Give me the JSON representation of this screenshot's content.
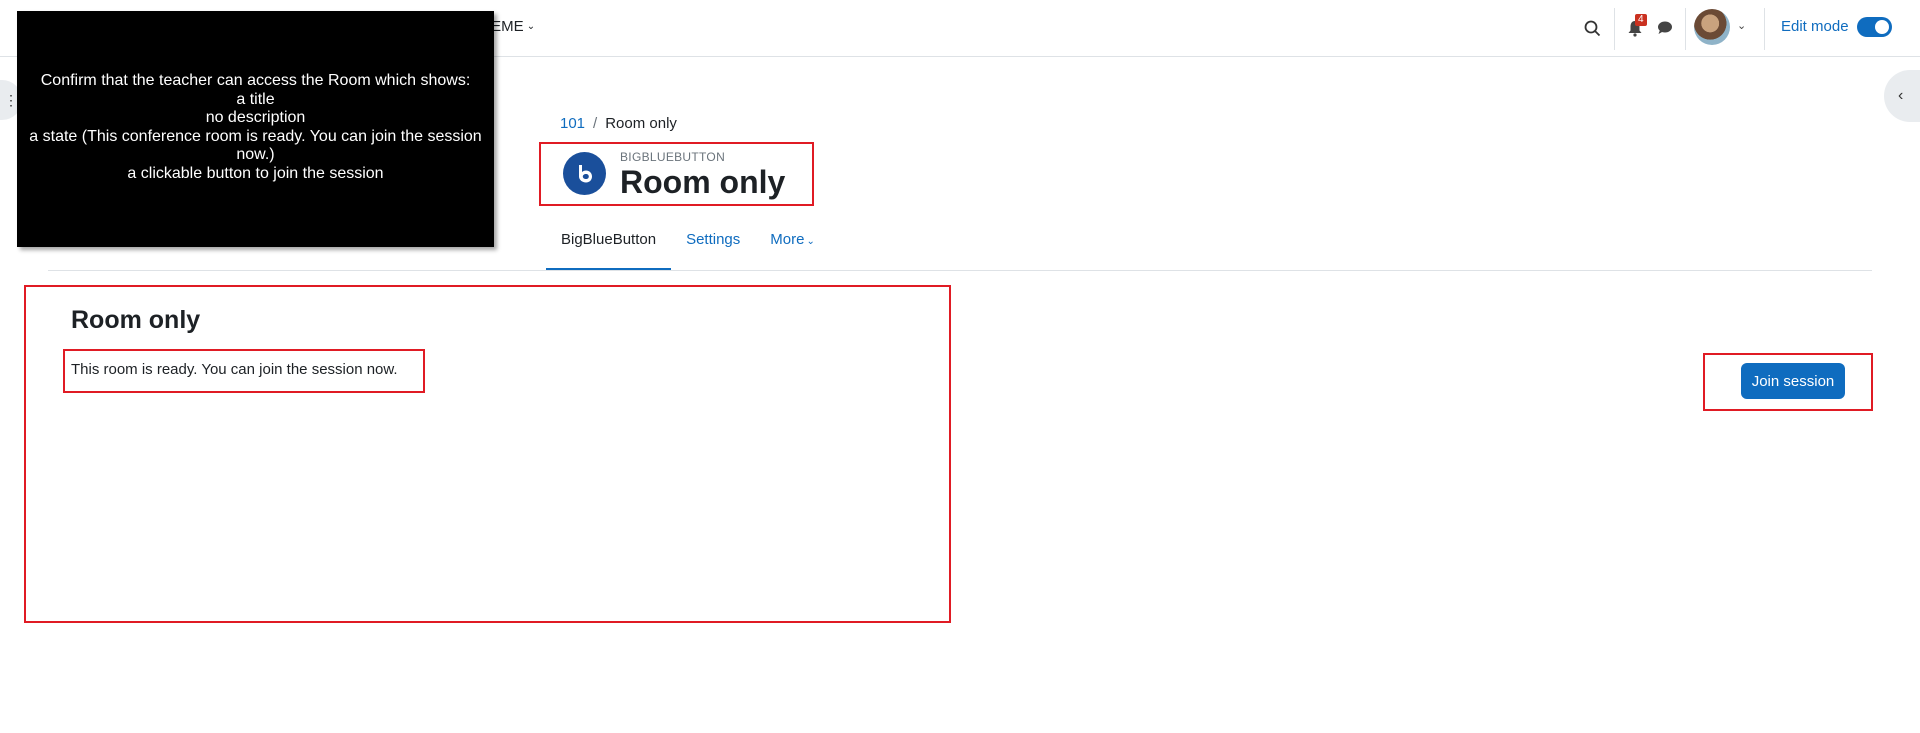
{
  "navbar": {
    "theme_menu_label": "IEME",
    "notification_count": "4",
    "edit_mode_label": "Edit mode"
  },
  "overlay": {
    "lines": [
      "Confirm that the teacher can access the Room which shows:",
      "a title",
      "no description",
      "a state (This conference room is ready. You can join the session now.)",
      "a clickable button to join the session"
    ]
  },
  "breadcrumb": {
    "course": "101",
    "separator": "/",
    "current": "Room only"
  },
  "header": {
    "module_type": "BIGBLUEBUTTON",
    "title": "Room only"
  },
  "tabs": [
    {
      "label": "BigBlueButton",
      "active": true
    },
    {
      "label": "Settings",
      "active": false
    },
    {
      "label": "More",
      "active": false
    }
  ],
  "content": {
    "room_title": "Room only",
    "status_text": "This room is ready. You can join the session now.",
    "join_button_label": "Join session"
  },
  "colors": {
    "primary": "#0f6cbf",
    "highlight_border": "#e01b24",
    "badge": "#ca3120"
  }
}
